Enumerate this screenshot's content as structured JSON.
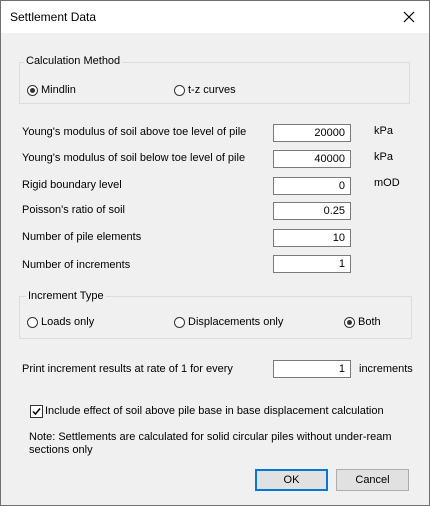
{
  "window": {
    "title": "Settlement Data"
  },
  "calc_method": {
    "label": "Calculation Method",
    "options": [
      {
        "label": "Mindlin",
        "selected": true
      },
      {
        "label": "t-z curves",
        "selected": false
      }
    ]
  },
  "fields": [
    {
      "label": "Young's modulus of soil above toe level of pile",
      "value": "20000",
      "unit": "kPa"
    },
    {
      "label": "Young's modulus of soil below toe level of pile",
      "value": "40000",
      "unit": "kPa"
    },
    {
      "label": "Rigid boundary level",
      "value": "0",
      "unit": "mOD"
    },
    {
      "label": "Poisson's ratio of soil",
      "value": "0.25",
      "unit": ""
    },
    {
      "label": "Number of pile elements",
      "value": "10",
      "unit": ""
    },
    {
      "label": "Number of increments",
      "value": "1",
      "unit": ""
    }
  ],
  "increment_type": {
    "label": "Increment Type",
    "options": [
      {
        "label": "Loads only",
        "selected": false
      },
      {
        "label": "Displacements only",
        "selected": false
      },
      {
        "label": "Both",
        "selected": true
      }
    ]
  },
  "print_rate": {
    "label": "Print increment results at rate of 1 for every",
    "value": "1",
    "unit": "increments"
  },
  "include_effect": {
    "label": "Include effect of soil above pile base in base displacement calculation",
    "checked": true
  },
  "note": {
    "line1": "Note: Settlements are calculated for solid circular piles without under-ream",
    "line2": "sections only"
  },
  "buttons": {
    "ok": "OK",
    "cancel": "Cancel"
  }
}
